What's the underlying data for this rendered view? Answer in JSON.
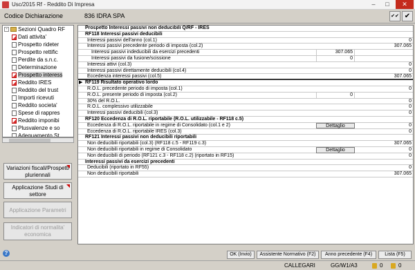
{
  "window": {
    "title": "Usc/2015 Rf - Reddito Di Impresa",
    "minimize": "–",
    "maximize": "□",
    "close": "✕"
  },
  "header": {
    "label": "Codice Dichiarazione",
    "ditta": "836  IDRA SPA",
    "btn1": "✔✔",
    "btn2": "✔"
  },
  "tree": {
    "root": "Sezioni Quadro RF",
    "items": [
      {
        "label": "Dati attivita'",
        "red": true
      },
      {
        "label": "Prospetto rideter",
        "red": false
      },
      {
        "label": "Prospetto rettific",
        "red": false
      },
      {
        "label": "Perdite da s.n.c.",
        "red": false
      },
      {
        "label": "Determinazione",
        "red": false
      },
      {
        "label": "Prospetto interess",
        "red": true,
        "selected": true
      },
      {
        "label": "Reddito IRES",
        "red": true
      },
      {
        "label": "Reddito del trust",
        "red": false
      },
      {
        "label": "Importi ricevuti",
        "red": false
      },
      {
        "label": "Reddito societa'",
        "red": false
      },
      {
        "label": "Spese di rappres",
        "red": false
      },
      {
        "label": "Reddito imponibi",
        "red": true
      },
      {
        "label": "Plusvalenze e so",
        "red": false
      },
      {
        "label": "Adeguamento St",
        "red": false
      }
    ]
  },
  "side_buttons": {
    "variazioni": [
      "Variazioni fiscali/Prospetti",
      "pluriennali"
    ],
    "studi": [
      "Applicazione Studi di",
      "settore"
    ],
    "parametri": [
      "Applicazione Parametri"
    ],
    "indicatori": [
      "Indicatori di normalita'",
      "economica"
    ]
  },
  "rows": [
    {
      "label": "Prospetto Interessi passivi non deducibili Q/RF - IRES",
      "style": "hdr",
      "indent": 0,
      "mid": "",
      "val": ""
    },
    {
      "label": "RF118 Interessi passivi deducibili",
      "style": "hdr",
      "indent": 0,
      "mid": "",
      "val": ""
    },
    {
      "label": "Interessi passivi dell'anno (col.1)",
      "style": "",
      "indent": 1,
      "mid": "",
      "val": "0"
    },
    {
      "label": "Interessi passivi precedente periodo di imposta (col.2)",
      "style": "",
      "indent": 1,
      "mid": "",
      "val": "307.065"
    },
    {
      "label": "Interessi passivi indeducibili da esercizi precedenti",
      "style": "",
      "indent": 2,
      "mid": "307.065",
      "val": ""
    },
    {
      "label": "Interessi passivi da fusione/scissione",
      "style": "",
      "indent": 2,
      "mid": "0",
      "val": ""
    },
    {
      "label": "Interessi attivi (col.3)",
      "style": "",
      "indent": 1,
      "mid": "",
      "val": "0"
    },
    {
      "label": "Interessi passivi direttamente deducibili (col.4)",
      "style": "",
      "indent": 1,
      "mid": "",
      "val": "0"
    },
    {
      "label": "Eccedenza interessi passivi (col.5)",
      "style": "thick",
      "indent": 1,
      "mid": "",
      "val": "307.065"
    },
    {
      "label": "RF119 Risultato operativo lordo",
      "style": "hdr",
      "indent": 0,
      "mid": "",
      "val": "",
      "ptr": true
    },
    {
      "label": "R.O.L. precedente periodo di imposta (col.1)",
      "style": "",
      "indent": 1,
      "mid": "",
      "val": "0"
    },
    {
      "label": "R.O.L. presente periodo di imposta (col.2)",
      "style": "",
      "indent": 1,
      "mid": "0",
      "val": ""
    },
    {
      "label": "30% del R.O.L.",
      "style": "",
      "indent": 1,
      "mid": "",
      "val": "0"
    },
    {
      "label": "R.O.L. complessivo utilizzabile",
      "style": "",
      "indent": 1,
      "mid": "",
      "val": "0"
    },
    {
      "label": "Interessi passivi deducibili (col.3)",
      "style": "",
      "indent": 1,
      "mid": "",
      "val": "0"
    },
    {
      "label": "RF120 Eccedenza di R.O.L. riportabile (R.O.L. utilizzabile - RF118 c.5)",
      "style": "hdr",
      "indent": 0,
      "mid": "",
      "val": ""
    },
    {
      "label": "Eccedenza di R.O.L. riportabile in regime di Consolidato (col.1 e 2)",
      "style": "",
      "indent": 1,
      "mid": "",
      "val": "0",
      "button": true
    },
    {
      "label": "Eccedenza di R.O.L. riportabile IRES (col.3)",
      "style": "",
      "indent": 1,
      "mid": "",
      "val": "0"
    },
    {
      "label": "RF121 Interessi passivi non deducibili riportabili",
      "style": "hdr",
      "indent": 0,
      "mid": "",
      "val": ""
    },
    {
      "label": "Non deducibili riportabili (col.3) (RF118 c.5 - RF119 c.3)",
      "style": "",
      "indent": 1,
      "mid": "",
      "val": "307.065"
    },
    {
      "label": "Non deducibili riportabili in regime di Consolidato",
      "style": "",
      "indent": 1,
      "mid": "",
      "val": "0",
      "button": true
    },
    {
      "label": "Non deducibili di periodo (RF121 c.3 - RF118 c.2) (riportato in RF15)",
      "style": "",
      "indent": 1,
      "mid": "",
      "val": "0"
    },
    {
      "label": "Interessi passivi da esercizi precedenti",
      "style": "hdr",
      "indent": 0,
      "mid": "",
      "val": ""
    },
    {
      "label": "Deducibili (riportato in RF55)",
      "style": "",
      "indent": 1,
      "mid": "",
      "val": "0"
    },
    {
      "label": "Non deducibili riportabili",
      "style": "",
      "indent": 1,
      "mid": "",
      "val": "307.065"
    }
  ],
  "button_dettaglio": "Dettaglio",
  "bottom": {
    "help": "?",
    "ok": "OK (Invio)",
    "assistente": "Assistente Normativo (F2)",
    "anno": "Anno precedente (F4)",
    "lista": "Lista (F5)"
  },
  "status": {
    "user": "CALLEGARI",
    "code": "GG/W1/A3",
    "n1": "0",
    "n2": "0"
  }
}
